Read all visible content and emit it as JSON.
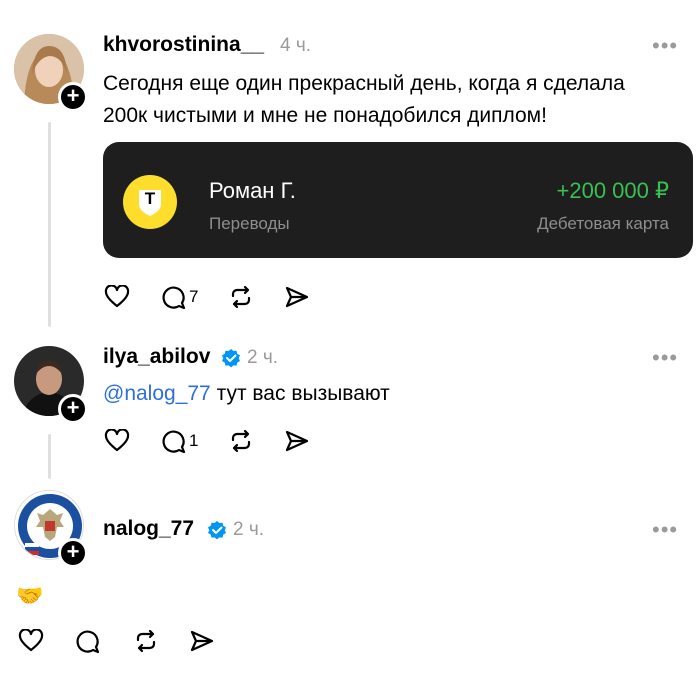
{
  "posts": [
    {
      "username": "khvorostinina__",
      "time": "4 ч.",
      "verified": false,
      "text_line1": "Сегодня еще один прекрасный день, когда я сделала",
      "text_line2": "200к чистыми и мне не понадобился диплом!",
      "transfer": {
        "name": "Роман Г.",
        "category": "Переводы",
        "amount": "+200 000 ₽",
        "account": "Дебетовая карта",
        "logo_letter": "Т"
      },
      "reply_count": "7"
    },
    {
      "username": "ilya_abilov",
      "time": "2 ч.",
      "verified": true,
      "mention": "@nalog_77",
      "text": " тут вас вызывают",
      "reply_count": "1"
    },
    {
      "username": "nalog_77",
      "time": "2 ч.",
      "verified": true,
      "text": "🤝",
      "reply_count": ""
    }
  ],
  "more_glyph": "•••",
  "plus_glyph": "+",
  "colors": {
    "mention": "#2e6fd8",
    "verified": "#0095f6",
    "amount_positive": "#3bbf52",
    "card_bg": "#1e1e1e",
    "bank_logo": "#ffdd2d"
  }
}
